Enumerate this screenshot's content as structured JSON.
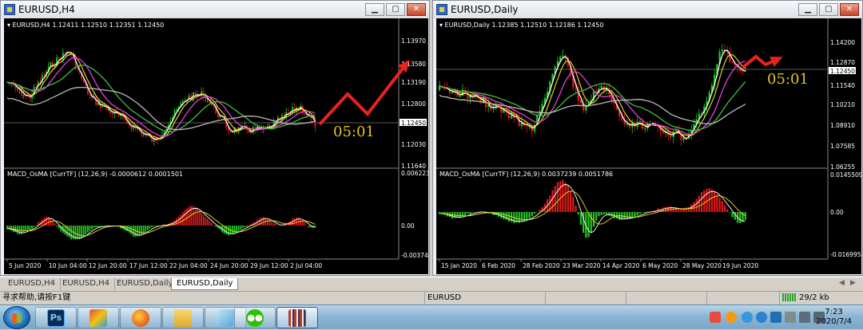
{
  "left_window": {
    "title": "EURUSD,H4",
    "info": "▾ EURUSD,H4  1.12411 1.12510 1.12351 1.12450",
    "macd_label": "MACD_OsMA [CurrTF] (12,26,9) -0.0000612 0.0001501",
    "price_ticks": [
      "1.13970",
      "1.13580",
      "1.13190",
      "1.12800",
      "1.12450",
      "1.12030",
      "1.11640"
    ],
    "macd_ticks": [
      "0.0062239",
      "0.00",
      "-0.003744"
    ],
    "date_ticks": [
      "5 Jun 2020",
      "10 Jun 04:00",
      "12 Jun 20:00",
      "17 Jun 12:00",
      "22 Jun 04:00",
      "24 Jun 20:00",
      "29 Jun 12:00",
      "2 Jul 04:00"
    ],
    "countdown": "05:01"
  },
  "right_window": {
    "title": "EURUSD,Daily",
    "info": "▾ EURUSD,Daily  1.12385 1.12510 1.12186 1.12450",
    "macd_label": "MACD_OsMA [CurrTF] (12,26,9) 0.0037239 0.0051786",
    "price_ticks": [
      "1.14200",
      "1.12870",
      "1.12450",
      "1.11540",
      "1.10210",
      "1.08910",
      "1.07585",
      "1.06255"
    ],
    "macd_ticks": [
      "0.0145509",
      "0.00",
      "-0.016995"
    ],
    "date_ticks": [
      "15 Jan 2020",
      "6 Feb 2020",
      "28 Feb 2020",
      "23 Mar 2020",
      "14 Apr 2020",
      "6 May 2020",
      "28 May 2020",
      "19 Jun 2020"
    ],
    "countdown": "05:01"
  },
  "tabs": [
    "EURUSD,H4",
    "EURUSD,H4",
    "EURUSD,Daily",
    "EURUSD,Daily"
  ],
  "active_tab": 3,
  "status": {
    "help": "寻求帮助,请按F1键",
    "symbol": "EURUSD",
    "traffic": "29/2 kb"
  },
  "taskbar": {
    "apps": [
      "photoshop",
      "paint",
      "firefox",
      "folder",
      "notepad",
      "wechat",
      "metatrader"
    ],
    "time": "7:23",
    "date": "2020/7/4"
  },
  "colors": {
    "bull_candle": "#22c422",
    "bear_candle": "#e01818",
    "ma_fast": "#ffffff",
    "ma_mid": "#f0e020",
    "ma_magenta": "#e040e0",
    "ma_green": "#40c040",
    "ma_gray": "#bbbbbb",
    "arrow": "#e8231e",
    "countdown": "#e6c619",
    "price_bg": "#ffffff"
  }
}
